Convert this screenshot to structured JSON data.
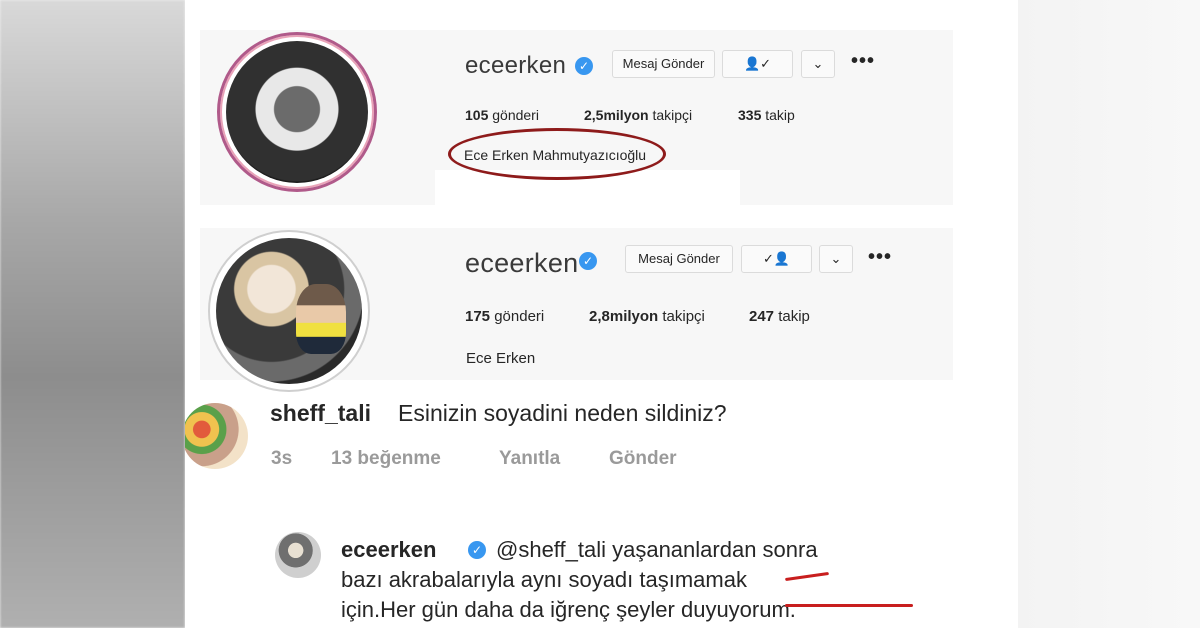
{
  "profile_old": {
    "username": "eceerken",
    "message_button": "Mesaj Gönder",
    "posts_count": "105",
    "posts_label": "gönderi",
    "followers_count": "2,5milyon",
    "followers_label": "takipçi",
    "following_count": "335",
    "following_label": "takip",
    "full_name": "Ece Erken Mahmutyazıcıoğlu",
    "more_icon": "•••"
  },
  "profile_new": {
    "username": "eceerken",
    "message_button": "Mesaj Gönder",
    "posts_count": "175",
    "posts_label": "gönderi",
    "followers_count": "2,8milyon",
    "followers_label": "takipçi",
    "following_count": "247",
    "following_label": "takip",
    "full_name": "Ece Erken",
    "more_icon": "•••"
  },
  "comment": {
    "username": "sheff_tali",
    "text": "Esinizin soyadini neden sildiniz?",
    "time": "3s",
    "likes": "13 beğenme",
    "reply_label": "Yanıtla",
    "send_label": "Gönder"
  },
  "reply": {
    "username": "eceerken",
    "line1": "@sheff_tali yaşananlardan sonra",
    "line2": "bazı akrabalarıyla aynı soyadı taşımamak",
    "line3": "için.Her gün daha da iğrenç şeyler duyuyorum."
  },
  "colors": {
    "verified_blue": "#3897f0",
    "highlight_red": "#8e1b1b"
  },
  "icons": {
    "verified": "verified-badge-icon",
    "following": "user-check-icon",
    "dropdown": "chevron-down-icon",
    "more": "more-dots-icon"
  }
}
